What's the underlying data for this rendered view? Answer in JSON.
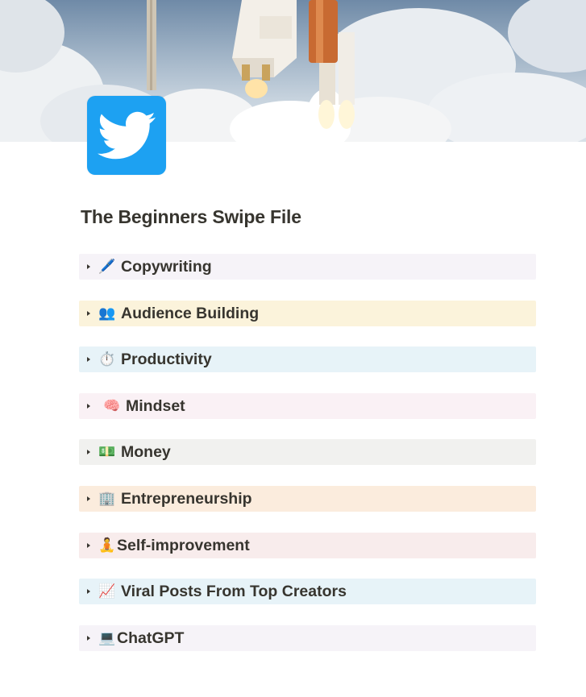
{
  "cover": {
    "description_icon": "rocket-launch-cover-image"
  },
  "page_icon": {
    "icon": "twitter-bird-icon",
    "color": "#1da1f2"
  },
  "page": {
    "title": "The Beginners Swipe File"
  },
  "toggles": [
    {
      "emoji": "🖊️",
      "icon": "pen-icon",
      "label": "Copywriting",
      "bg": "#f6f3f8"
    },
    {
      "emoji": "👥",
      "icon": "people-icon",
      "label": "Audience Building",
      "bg": "#fbf3db"
    },
    {
      "emoji": "⏱️",
      "icon": "stopwatch-icon",
      "label": "Productivity",
      "bg": "#e7f3f8"
    },
    {
      "emoji": "🧠",
      "icon": "brain-icon",
      "label": "Mindset",
      "bg": "#faf1f5"
    },
    {
      "emoji": "💵",
      "icon": "money-icon",
      "label": "Money",
      "bg": "#f1f1ef"
    },
    {
      "emoji": "🏢",
      "icon": "office-building-icon",
      "label": "Entrepreneurship",
      "bg": "#fbecdd"
    },
    {
      "emoji": "🧘",
      "icon": "meditation-icon",
      "label": "Self-improvement",
      "bg": "#f8ecec"
    },
    {
      "emoji": "📈",
      "icon": "chart-increasing-icon",
      "label": "Viral Posts From Top Creators",
      "bg": "#e7f3f8"
    },
    {
      "emoji": "💻",
      "icon": "laptop-icon",
      "label": "ChatGPT",
      "bg": "#f6f3f8"
    }
  ]
}
